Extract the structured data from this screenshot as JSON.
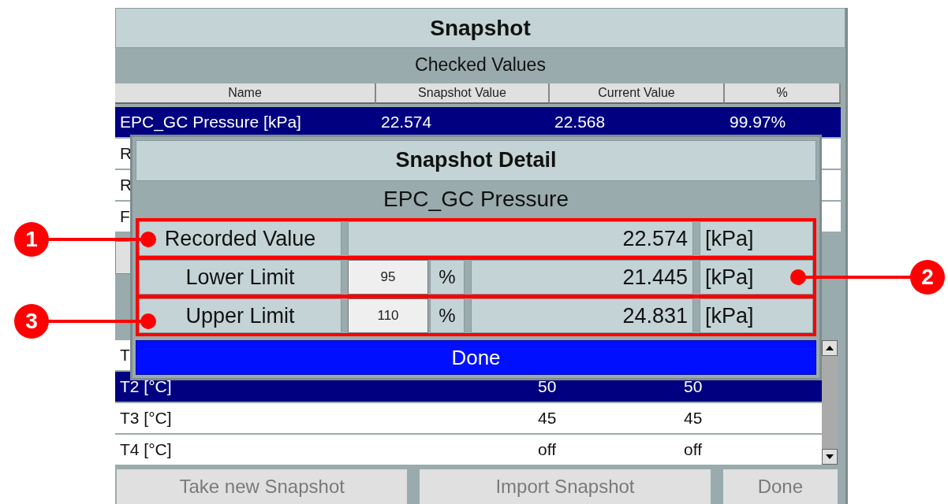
{
  "window": {
    "title": "Snapshot",
    "section": "Checked Values"
  },
  "table": {
    "columns": [
      "Name",
      "Snapshot Value",
      "Current Value",
      "%"
    ],
    "rows": [
      {
        "cells": [
          "EPC_GC Pressure [kPa]",
          "22.574",
          "22.568",
          "99.97%"
        ],
        "selected": true
      },
      {
        "cells": [
          "R"
        ],
        "selected": false
      },
      {
        "cells": [
          "R"
        ],
        "selected": false
      },
      {
        "cells": [
          "F"
        ],
        "selected": false
      }
    ]
  },
  "lower_table": {
    "rows": [
      {
        "cells": [
          "T"
        ],
        "selected": false
      },
      {
        "cells": [
          "T2 [°C]",
          "50",
          "50"
        ],
        "selected": true
      },
      {
        "cells": [
          "T3 [°C]",
          "45",
          "45"
        ],
        "selected": false
      },
      {
        "cells": [
          "T4 [°C]",
          "off",
          "off"
        ],
        "selected": false
      }
    ]
  },
  "buttons": [
    {
      "label": "Take new Snapshot",
      "disabled": true
    },
    {
      "label": "Import Snapshot",
      "disabled": true
    },
    {
      "label": "Done",
      "disabled": true
    }
  ],
  "dialog": {
    "title": "Snapshot Detail",
    "subtitle": "EPC_GC Pressure",
    "rows": [
      {
        "kind": "value",
        "label": "Recorded Value",
        "value": "22.574",
        "unit": "[kPa]"
      },
      {
        "kind": "limit",
        "label": "Lower Limit",
        "percent": "95",
        "percent_unit": "%",
        "value": "21.445",
        "unit": "[kPa]"
      },
      {
        "kind": "limit",
        "label": "Upper Limit",
        "percent": "110",
        "percent_unit": "%",
        "value": "24.831",
        "unit": "[kPa]"
      }
    ],
    "done": "Done"
  },
  "callouts": [
    "1",
    "2",
    "3"
  ]
}
